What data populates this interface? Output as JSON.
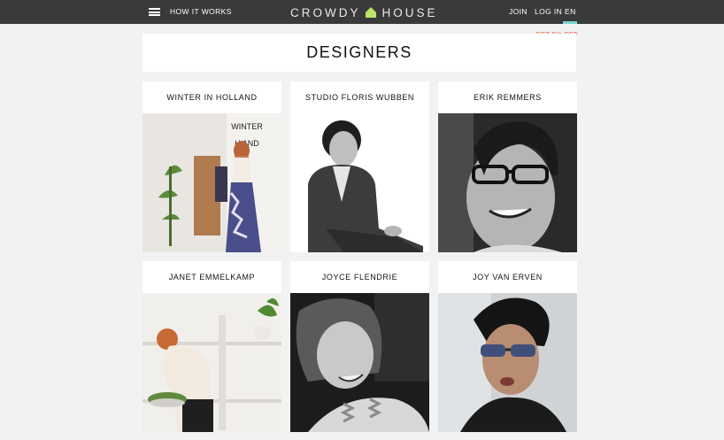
{
  "nav": {
    "how_it_works": "HOW IT WORKS",
    "logo_left": "CROWDY",
    "logo_right": "HOUSE",
    "join": "JOIN",
    "login": "LOG IN",
    "lang": "EN",
    "promo": "GET 5% OFF"
  },
  "page": {
    "title": "DESIGNERS"
  },
  "designers": [
    {
      "name": "WINTER IN HOLLAND",
      "photo_sign": "WINTER\nIN\nHOLLAND"
    },
    {
      "name": "STUDIO FLORIS WUBBEN"
    },
    {
      "name": "ERIK REMMERS"
    },
    {
      "name": "JANET EMMELKAMP"
    },
    {
      "name": "JOYCE FLENDRIE"
    },
    {
      "name": "JOY VAN ERVEN"
    }
  ],
  "colors": {
    "topbar": "#3a3a3a",
    "logo_house": "#b9e36a",
    "lang_underline": "#7ad6d0",
    "promo": "#e35b3c",
    "background": "#f2f2f2"
  }
}
